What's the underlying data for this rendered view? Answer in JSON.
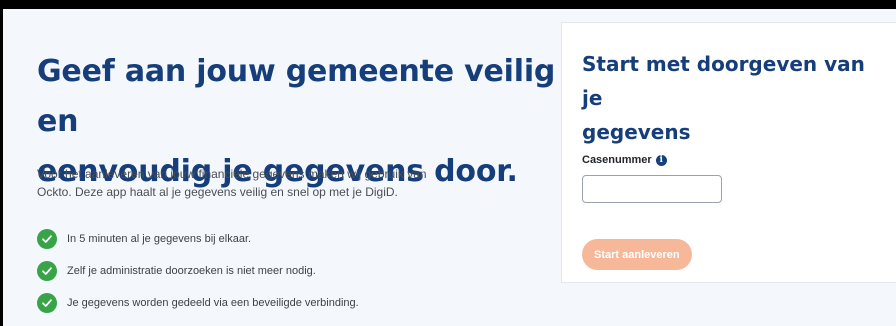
{
  "hero": {
    "headline_line1": "Geef aan jouw gemeente veilig en",
    "headline_line2": "eenvoudig je gegevens door.",
    "intro_line1": "Voor het aanleveren van jouw financiële gegevens maken wij gebruik van",
    "intro_line2": "Ockto. Deze app haalt al je gegevens veilig en snel op met je DigiD."
  },
  "benefits": [
    {
      "text": "In 5 minuten al je gegevens bij elkaar.",
      "icon": "check-circle-icon"
    },
    {
      "text": "Zelf je administratie doorzoeken is niet meer nodig.",
      "icon": "check-circle-icon"
    },
    {
      "text": "Je gegevens worden gedeeld via een beveiligde verbinding.",
      "icon": "check-circle-icon"
    }
  ],
  "form": {
    "title_line1": "Start met doorgeven van je",
    "title_line2": "gegevens",
    "field_label": "Casenummer",
    "info_glyph": "i",
    "field_value": "",
    "field_placeholder": "",
    "submit_label": "Start aanleveren"
  },
  "colors": {
    "brand_blue": "#163e7a",
    "check_green": "#36a447",
    "button_disabled": "#f6b899",
    "page_background": "#f4f8fc"
  }
}
